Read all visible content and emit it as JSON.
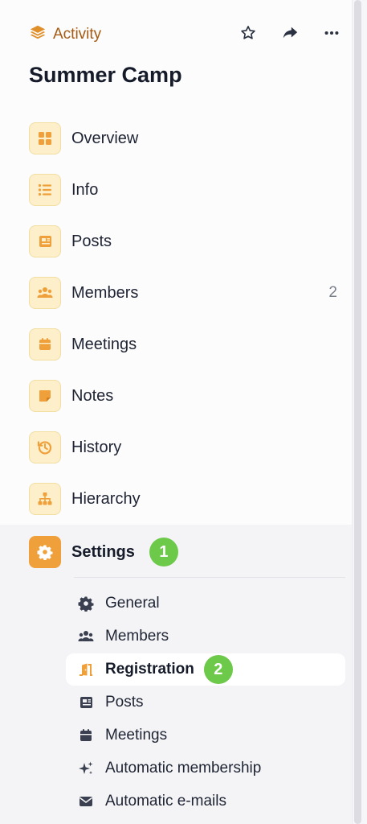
{
  "header": {
    "breadcrumb": "Activity",
    "breadcrumb_icon": "layers-icon",
    "actions": [
      "star-icon",
      "share-icon",
      "more-icon"
    ]
  },
  "page_title": "Summer Camp",
  "nav": {
    "items": [
      {
        "label": "Overview",
        "icon": "grid-icon"
      },
      {
        "label": "Info",
        "icon": "list-icon"
      },
      {
        "label": "Posts",
        "icon": "newspaper-icon"
      },
      {
        "label": "Members",
        "icon": "users-icon",
        "count": "2"
      },
      {
        "label": "Meetings",
        "icon": "calendar-icon"
      },
      {
        "label": "Notes",
        "icon": "note-icon"
      },
      {
        "label": "History",
        "icon": "history-icon"
      },
      {
        "label": "Hierarchy",
        "icon": "sitemap-icon"
      }
    ]
  },
  "settings": {
    "label": "Settings",
    "icon": "gear-icon",
    "badge": "1",
    "sub_items": [
      {
        "label": "General",
        "icon": "gear-icon"
      },
      {
        "label": "Members",
        "icon": "users-icon"
      },
      {
        "label": "Registration",
        "icon": "door-icon",
        "active": true,
        "badge": "2"
      },
      {
        "label": "Posts",
        "icon": "newspaper-icon"
      },
      {
        "label": "Meetings",
        "icon": "calendar-icon"
      },
      {
        "label": "Automatic membership",
        "icon": "sparkles-icon"
      },
      {
        "label": "Automatic e-mails",
        "icon": "envelope-icon"
      }
    ]
  },
  "colors": {
    "accent": "#f0a03a",
    "breadcrumb": "#a45a10",
    "badge_green": "#6cc94a",
    "icon_bg": "#fcefc9"
  }
}
